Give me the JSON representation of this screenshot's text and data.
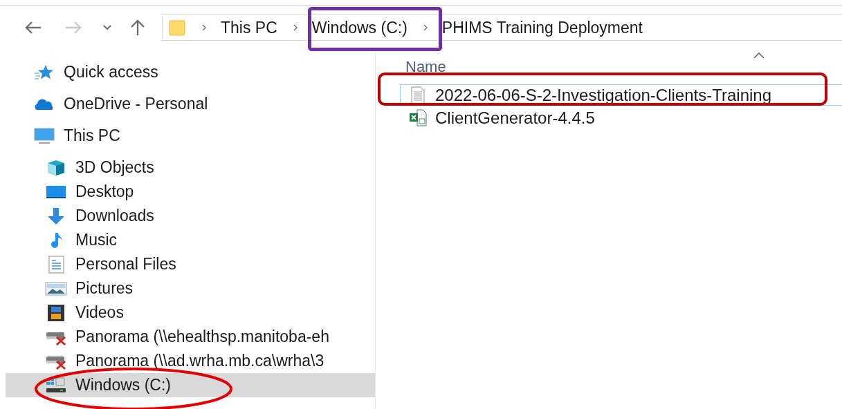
{
  "navigation": [
    {
      "kind": "back",
      "disabled": false
    },
    {
      "kind": "forward",
      "disabled": true
    },
    {
      "kind": "recent",
      "disabled": false
    },
    {
      "kind": "up",
      "disabled": false
    }
  ],
  "address_bar": {
    "crumbs": [
      {
        "label": "This PC"
      },
      {
        "label": "Windows (C:)",
        "annotation": {
          "kind": "rect",
          "color": "#7030a0"
        }
      },
      {
        "label": "PHIMS Training Deployment"
      }
    ]
  },
  "sidebar": {
    "items": [
      {
        "label": "Quick access",
        "kind": "quick-access",
        "selected": false
      },
      {
        "label": "OneDrive - Personal",
        "kind": "cloud",
        "selected": false
      },
      {
        "label": "This PC",
        "kind": "computer",
        "selected": false,
        "children": [
          {
            "label": "3D Objects",
            "kind": "objects-3d",
            "selected": false
          },
          {
            "label": "Desktop",
            "kind": "desktop",
            "selected": false
          },
          {
            "label": "Downloads",
            "kind": "downloads",
            "selected": false
          },
          {
            "label": "Music",
            "kind": "music",
            "selected": false
          },
          {
            "label": "Personal Files",
            "kind": "documents",
            "selected": false
          },
          {
            "label": "Pictures",
            "kind": "pictures",
            "selected": false
          },
          {
            "label": "Videos",
            "kind": "videos",
            "selected": false
          },
          {
            "label": "Panorama (\\\\ehealthsp.manitoba-eh",
            "kind": "disconnected-drive",
            "selected": false
          },
          {
            "label": "Panorama (\\\\ad.wrha.mb.ca\\wrha\\3",
            "kind": "disconnected-drive",
            "selected": false
          },
          {
            "label": "Windows (C:)",
            "kind": "system-drive",
            "selected": true,
            "annotation": {
              "kind": "ellipse",
              "color": "#e00000"
            }
          }
        ]
      }
    ]
  },
  "file_list": {
    "columns": [
      {
        "label": "Name",
        "sorted": true
      }
    ],
    "files": [
      {
        "name": "2022-06-06-S-2-Investigation-Clients-Training",
        "kind": "text-document",
        "focused": true,
        "annotation": {
          "kind": "rounded-rect",
          "color": "#c00000"
        }
      },
      {
        "name": "ClientGenerator-4.4.5",
        "kind": "spreadsheet",
        "focused": false
      }
    ]
  }
}
